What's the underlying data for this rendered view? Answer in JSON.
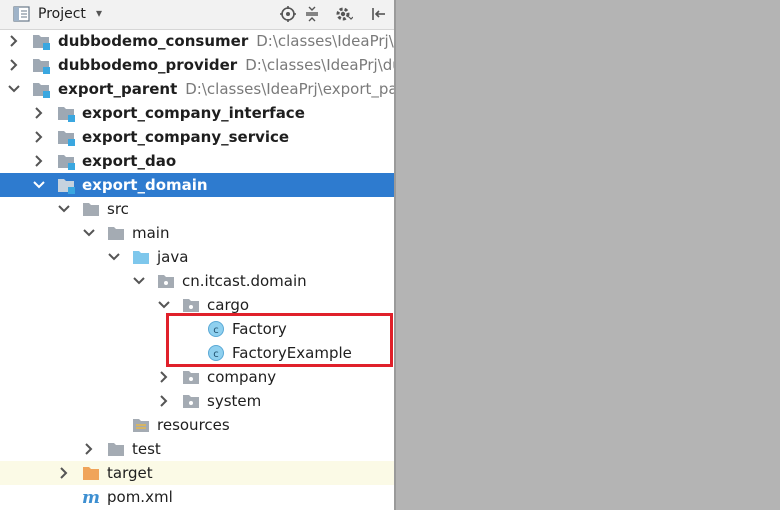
{
  "header": {
    "title": "Project",
    "caret": "▾"
  },
  "tree": {
    "items": [
      {
        "label": "dubbodemo_consumer",
        "path": "D:\\classes\\IdeaPrj\\dubbodemo_consumer"
      },
      {
        "label": "dubbodemo_provider",
        "path": "D:\\classes\\IdeaPrj\\dubbodemo_provider"
      },
      {
        "label": "export_parent",
        "path": "D:\\classes\\IdeaPrj\\export_parent"
      },
      {
        "label": "export_company_interface"
      },
      {
        "label": "export_company_service"
      },
      {
        "label": "export_dao"
      },
      {
        "label": "export_domain"
      },
      {
        "label": "src"
      },
      {
        "label": "main"
      },
      {
        "label": "java"
      },
      {
        "label": "cn.itcast.domain"
      },
      {
        "label": "cargo"
      },
      {
        "label": "Factory"
      },
      {
        "label": "FactoryExample"
      },
      {
        "label": "company"
      },
      {
        "label": "system"
      },
      {
        "label": "resources"
      },
      {
        "label": "test"
      },
      {
        "label": "target"
      },
      {
        "label": "pom.xml"
      }
    ]
  },
  "colors": {
    "selection": "#2e7bcf",
    "highlight_box": "#e0202a",
    "class_icon": "#8fd0ef",
    "module_badge": "#3aa7e0",
    "target_folder": "#f0a45a"
  }
}
